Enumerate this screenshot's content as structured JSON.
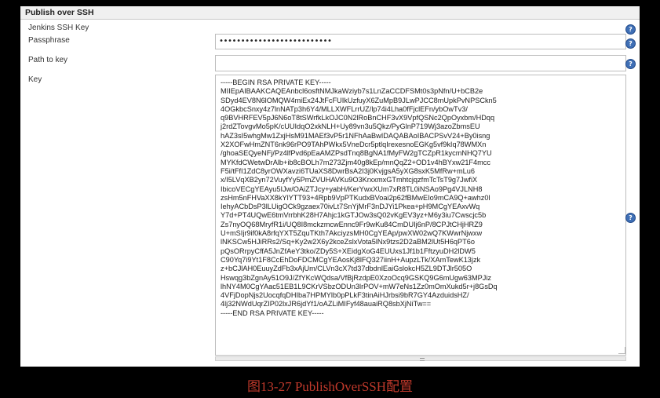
{
  "section": {
    "title": "Publish over SSH"
  },
  "fields": {
    "jenkins_ssh_key": {
      "label": "Jenkins SSH Key"
    },
    "passphrase": {
      "label": "Passphrase",
      "value": "••••••••••••••••••••••••••"
    },
    "path_to_key": {
      "label": "Path to key",
      "value": ""
    },
    "key": {
      "label": "Key",
      "value": "-----BEGIN RSA PRIVATE KEY-----\nMIIEpAIBAAKCAQEAnbcl6osftNMJkaWziyb7s1LnZaCCDFSMt0s3pNfn/U+bCB2e\nSDyd4EV8N6lOMQW4miEx24JtFcFUIkUzfuyX6ZuMpB9JLwPJCC8mUpkPvNPSCkn5\n4OGkbcSnxy4z7lnNATp3h6Y4/MLLXWFLrrUZ/lp74i4Lha0fFjclEFn/ybOwTv3/\nq9BVHRFEV5pJ6N6oT8tSWrfkLkOJC0N2lRoBnCHF3vX9VpfQSNc2QpOyxbm/HDqq\nj2rdZTovgvMo5pK/cUUIdqO2xkNLH+Uy89vn3u5Qkz/PyGlnP719Wj3azoZbmsEU\nhAZ3sI5whgMw1ZxjHsM91MAEf3vP5r1NFhAaBwIDAQABAoIBACPSvV24+By0isng\nX2XOFwHmZNT6nk96rPO9TAhPWkx5VneDcr5ptlqIrexesnoEGKg5vf9kIq78WMXn\n/ghoaSEQyeNFj/Pz4lfPvd6pEaAMZPsdTnq8BgNA1fMyFW2gTCZpR1kycmNHQ7YU\nMYKfdCWetwDrAlb+ib8cBOLh7m273Zjm40g8kEp/mnQqZ2+OD1v4hBYxw21F4mcc\nF5i/tFfI1ZdC8yrOWXavzi6TUaXS8DwrBsA2I3j0KvjgsA5yXG8sxK5MfRw+mLu6\nx/I5LVqXB2yn72VuyfYy5PmZVUHAVKu9O3KrxxmxGTmhtcjqzfmTcTsT9g7JwfiX\nIbicoVECgYEAyu5IJw/OAiZTJcy+yabH/KerYwxXUm7xR8TL0iNSAo9Pg4VJLNH8\nzsHm5nFHVaXX8kYlYTT93+4Rpb9VpPTKudxBVoai2p62fBMwEIo9mCA9Q+awhz0l\nIehyACbDsP3lLUigOCk9gzaex70ivLt7SnYjMrF3nDJYi1Pkea+pH9MCgYEAxvWq\nY7d+PT4UQwE6tmVrrbhK28H7Ahjc1kGTJOw3sQ02vKgEV3yz+M6y3iu7Cwscjc5b\nZs7nyOQ68MryfR1i/UQ8I8mckzmcwEnnc9Fr9wKu84CmDUIj6nP/8CPJtCHjHRZ9\nU+mSIjr9if0kA8rfqYXT5ZquTKth7AkciyzsMH0CgYEAp/pwXW02wQ7KWwrNjwxw\nlNKSCw5HJiRRs2/Sq+Ky2w2X6y2kceZslxVota5lNx9tzs2D2aBM2lUt5H6qPT6o\npQsORrpyCffA5JnZfAeY3tko/ZDy5S+XEidgXoG4EUUxs1Jf1b1FftzyuDH2lDW5\nC90Yq7i9Yt1F8CcEhDoFDCMCgYEAosKj8lFQ327iinH+AupzLTk/XAmTewK13jzk\nz+bCJlAH0EuuyZdFb3xAjUm/CLVn3cX7td37dbdnlEaiGslokcH5ZL9DTJlr505O\nHswqg3bZgnAy51O9J/ZfYKcWQdsa/VfBjRzdpE0XzoOcq9GSKQ9G6mUgw63MPJiz\nlhNY4M0CgYAac51EB1L9CKrVSbzODUn3lrPOV+mW7eNs1Zz0mOmXukd5r+j8GsDq\n4VFjDopNjs2UocqfqDHIba7HPMYlb0pPLkF3tinAiHJrbsi9bR7GY4AzduidsHZ/\n4lj32NWdUqrZIP02lxJR6jdYf1/oAZLiMIFyf48auaiRQ8sbXjNiTw==\n-----END RSA PRIVATE KEY-----"
    }
  },
  "help_icon": {
    "glyph": "?"
  },
  "caption": "图13-27 PublishOverSSH配置"
}
